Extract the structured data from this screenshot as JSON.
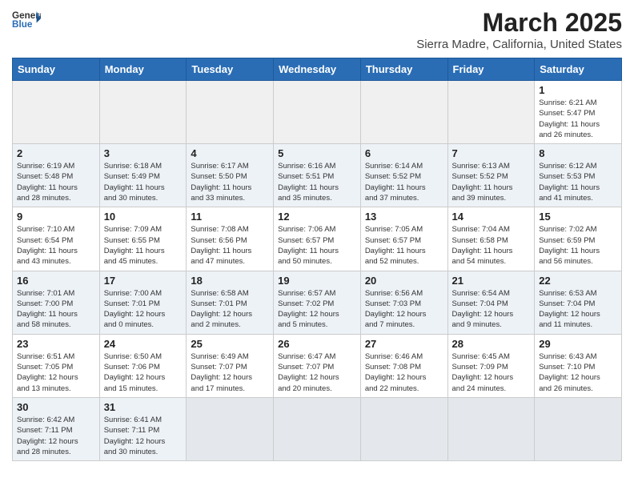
{
  "header": {
    "logo_general": "General",
    "logo_blue": "Blue",
    "title": "March 2025",
    "subtitle": "Sierra Madre, California, United States"
  },
  "days_of_week": [
    "Sunday",
    "Monday",
    "Tuesday",
    "Wednesday",
    "Thursday",
    "Friday",
    "Saturday"
  ],
  "weeks": [
    [
      {
        "day": "",
        "info": ""
      },
      {
        "day": "",
        "info": ""
      },
      {
        "day": "",
        "info": ""
      },
      {
        "day": "",
        "info": ""
      },
      {
        "day": "",
        "info": ""
      },
      {
        "day": "",
        "info": ""
      },
      {
        "day": "1",
        "info": "Sunrise: 6:21 AM\nSunset: 5:47 PM\nDaylight: 11 hours\nand 26 minutes."
      }
    ],
    [
      {
        "day": "2",
        "info": "Sunrise: 6:19 AM\nSunset: 5:48 PM\nDaylight: 11 hours\nand 28 minutes."
      },
      {
        "day": "3",
        "info": "Sunrise: 6:18 AM\nSunset: 5:49 PM\nDaylight: 11 hours\nand 30 minutes."
      },
      {
        "day": "4",
        "info": "Sunrise: 6:17 AM\nSunset: 5:50 PM\nDaylight: 11 hours\nand 33 minutes."
      },
      {
        "day": "5",
        "info": "Sunrise: 6:16 AM\nSunset: 5:51 PM\nDaylight: 11 hours\nand 35 minutes."
      },
      {
        "day": "6",
        "info": "Sunrise: 6:14 AM\nSunset: 5:52 PM\nDaylight: 11 hours\nand 37 minutes."
      },
      {
        "day": "7",
        "info": "Sunrise: 6:13 AM\nSunset: 5:52 PM\nDaylight: 11 hours\nand 39 minutes."
      },
      {
        "day": "8",
        "info": "Sunrise: 6:12 AM\nSunset: 5:53 PM\nDaylight: 11 hours\nand 41 minutes."
      }
    ],
    [
      {
        "day": "9",
        "info": "Sunrise: 7:10 AM\nSunset: 6:54 PM\nDaylight: 11 hours\nand 43 minutes."
      },
      {
        "day": "10",
        "info": "Sunrise: 7:09 AM\nSunset: 6:55 PM\nDaylight: 11 hours\nand 45 minutes."
      },
      {
        "day": "11",
        "info": "Sunrise: 7:08 AM\nSunset: 6:56 PM\nDaylight: 11 hours\nand 47 minutes."
      },
      {
        "day": "12",
        "info": "Sunrise: 7:06 AM\nSunset: 6:57 PM\nDaylight: 11 hours\nand 50 minutes."
      },
      {
        "day": "13",
        "info": "Sunrise: 7:05 AM\nSunset: 6:57 PM\nDaylight: 11 hours\nand 52 minutes."
      },
      {
        "day": "14",
        "info": "Sunrise: 7:04 AM\nSunset: 6:58 PM\nDaylight: 11 hours\nand 54 minutes."
      },
      {
        "day": "15",
        "info": "Sunrise: 7:02 AM\nSunset: 6:59 PM\nDaylight: 11 hours\nand 56 minutes."
      }
    ],
    [
      {
        "day": "16",
        "info": "Sunrise: 7:01 AM\nSunset: 7:00 PM\nDaylight: 11 hours\nand 58 minutes."
      },
      {
        "day": "17",
        "info": "Sunrise: 7:00 AM\nSunset: 7:01 PM\nDaylight: 12 hours\nand 0 minutes."
      },
      {
        "day": "18",
        "info": "Sunrise: 6:58 AM\nSunset: 7:01 PM\nDaylight: 12 hours\nand 2 minutes."
      },
      {
        "day": "19",
        "info": "Sunrise: 6:57 AM\nSunset: 7:02 PM\nDaylight: 12 hours\nand 5 minutes."
      },
      {
        "day": "20",
        "info": "Sunrise: 6:56 AM\nSunset: 7:03 PM\nDaylight: 12 hours\nand 7 minutes."
      },
      {
        "day": "21",
        "info": "Sunrise: 6:54 AM\nSunset: 7:04 PM\nDaylight: 12 hours\nand 9 minutes."
      },
      {
        "day": "22",
        "info": "Sunrise: 6:53 AM\nSunset: 7:04 PM\nDaylight: 12 hours\nand 11 minutes."
      }
    ],
    [
      {
        "day": "23",
        "info": "Sunrise: 6:51 AM\nSunset: 7:05 PM\nDaylight: 12 hours\nand 13 minutes."
      },
      {
        "day": "24",
        "info": "Sunrise: 6:50 AM\nSunset: 7:06 PM\nDaylight: 12 hours\nand 15 minutes."
      },
      {
        "day": "25",
        "info": "Sunrise: 6:49 AM\nSunset: 7:07 PM\nDaylight: 12 hours\nand 17 minutes."
      },
      {
        "day": "26",
        "info": "Sunrise: 6:47 AM\nSunset: 7:07 PM\nDaylight: 12 hours\nand 20 minutes."
      },
      {
        "day": "27",
        "info": "Sunrise: 6:46 AM\nSunset: 7:08 PM\nDaylight: 12 hours\nand 22 minutes."
      },
      {
        "day": "28",
        "info": "Sunrise: 6:45 AM\nSunset: 7:09 PM\nDaylight: 12 hours\nand 24 minutes."
      },
      {
        "day": "29",
        "info": "Sunrise: 6:43 AM\nSunset: 7:10 PM\nDaylight: 12 hours\nand 26 minutes."
      }
    ],
    [
      {
        "day": "30",
        "info": "Sunrise: 6:42 AM\nSunset: 7:11 PM\nDaylight: 12 hours\nand 28 minutes."
      },
      {
        "day": "31",
        "info": "Sunrise: 6:41 AM\nSunset: 7:11 PM\nDaylight: 12 hours\nand 30 minutes."
      },
      {
        "day": "",
        "info": ""
      },
      {
        "day": "",
        "info": ""
      },
      {
        "day": "",
        "info": ""
      },
      {
        "day": "",
        "info": ""
      },
      {
        "day": "",
        "info": ""
      }
    ]
  ]
}
